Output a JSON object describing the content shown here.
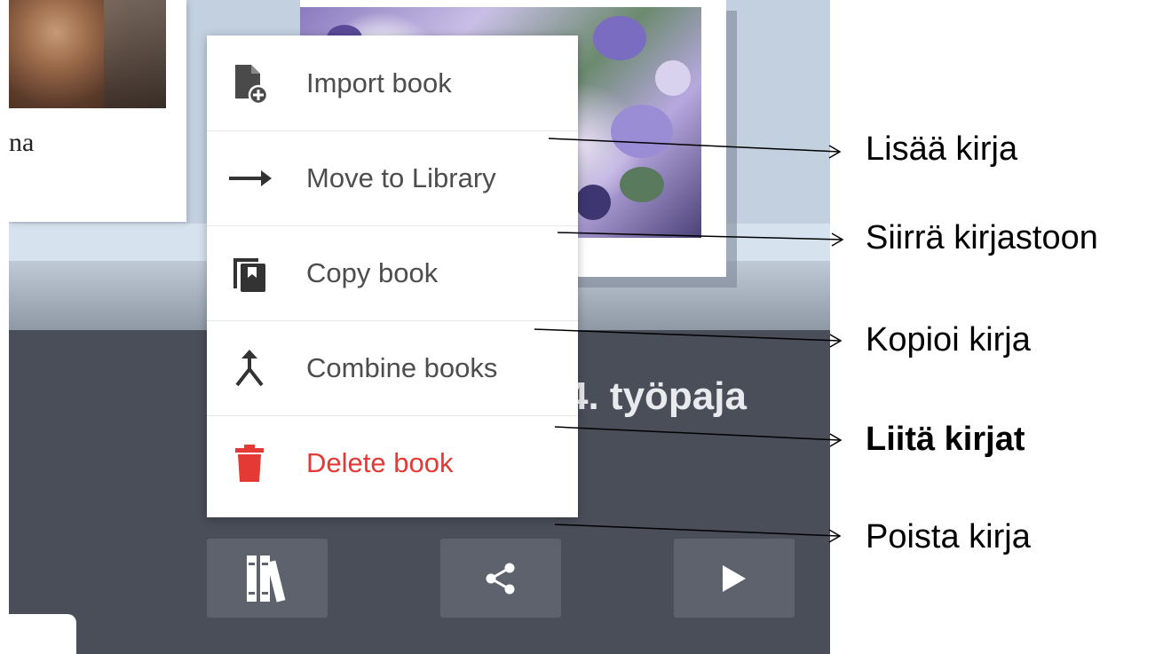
{
  "background_card": {
    "caption_fragment": "na"
  },
  "book_title_fragment": "4. työpaja",
  "menu": {
    "items": [
      {
        "label": "Import book",
        "icon": "file-add-icon"
      },
      {
        "label": "Move to Library",
        "icon": "arrow-right-icon"
      },
      {
        "label": "Copy book",
        "icon": "copy-book-icon"
      },
      {
        "label": "Combine books",
        "icon": "merge-icon"
      },
      {
        "label": "Delete book",
        "icon": "trash-icon",
        "color": "#e53935"
      }
    ]
  },
  "toolbar": {
    "buttons": [
      {
        "icon": "library-icon"
      },
      {
        "icon": "share-icon"
      },
      {
        "icon": "play-icon"
      }
    ]
  },
  "annotations": [
    {
      "text": "Lisää kirja"
    },
    {
      "text": "Siirrä kirjastoon"
    },
    {
      "text": "Kopioi kirja"
    },
    {
      "text": "Liitä kirjat",
      "bold": true
    },
    {
      "text": "Poista kirja"
    }
  ],
  "colors": {
    "panel_dark": "#4a4e59",
    "button_bg": "#5e626d",
    "menu_bg": "#ffffff",
    "danger": "#e53935",
    "menu_text": "#4d4d4d"
  }
}
